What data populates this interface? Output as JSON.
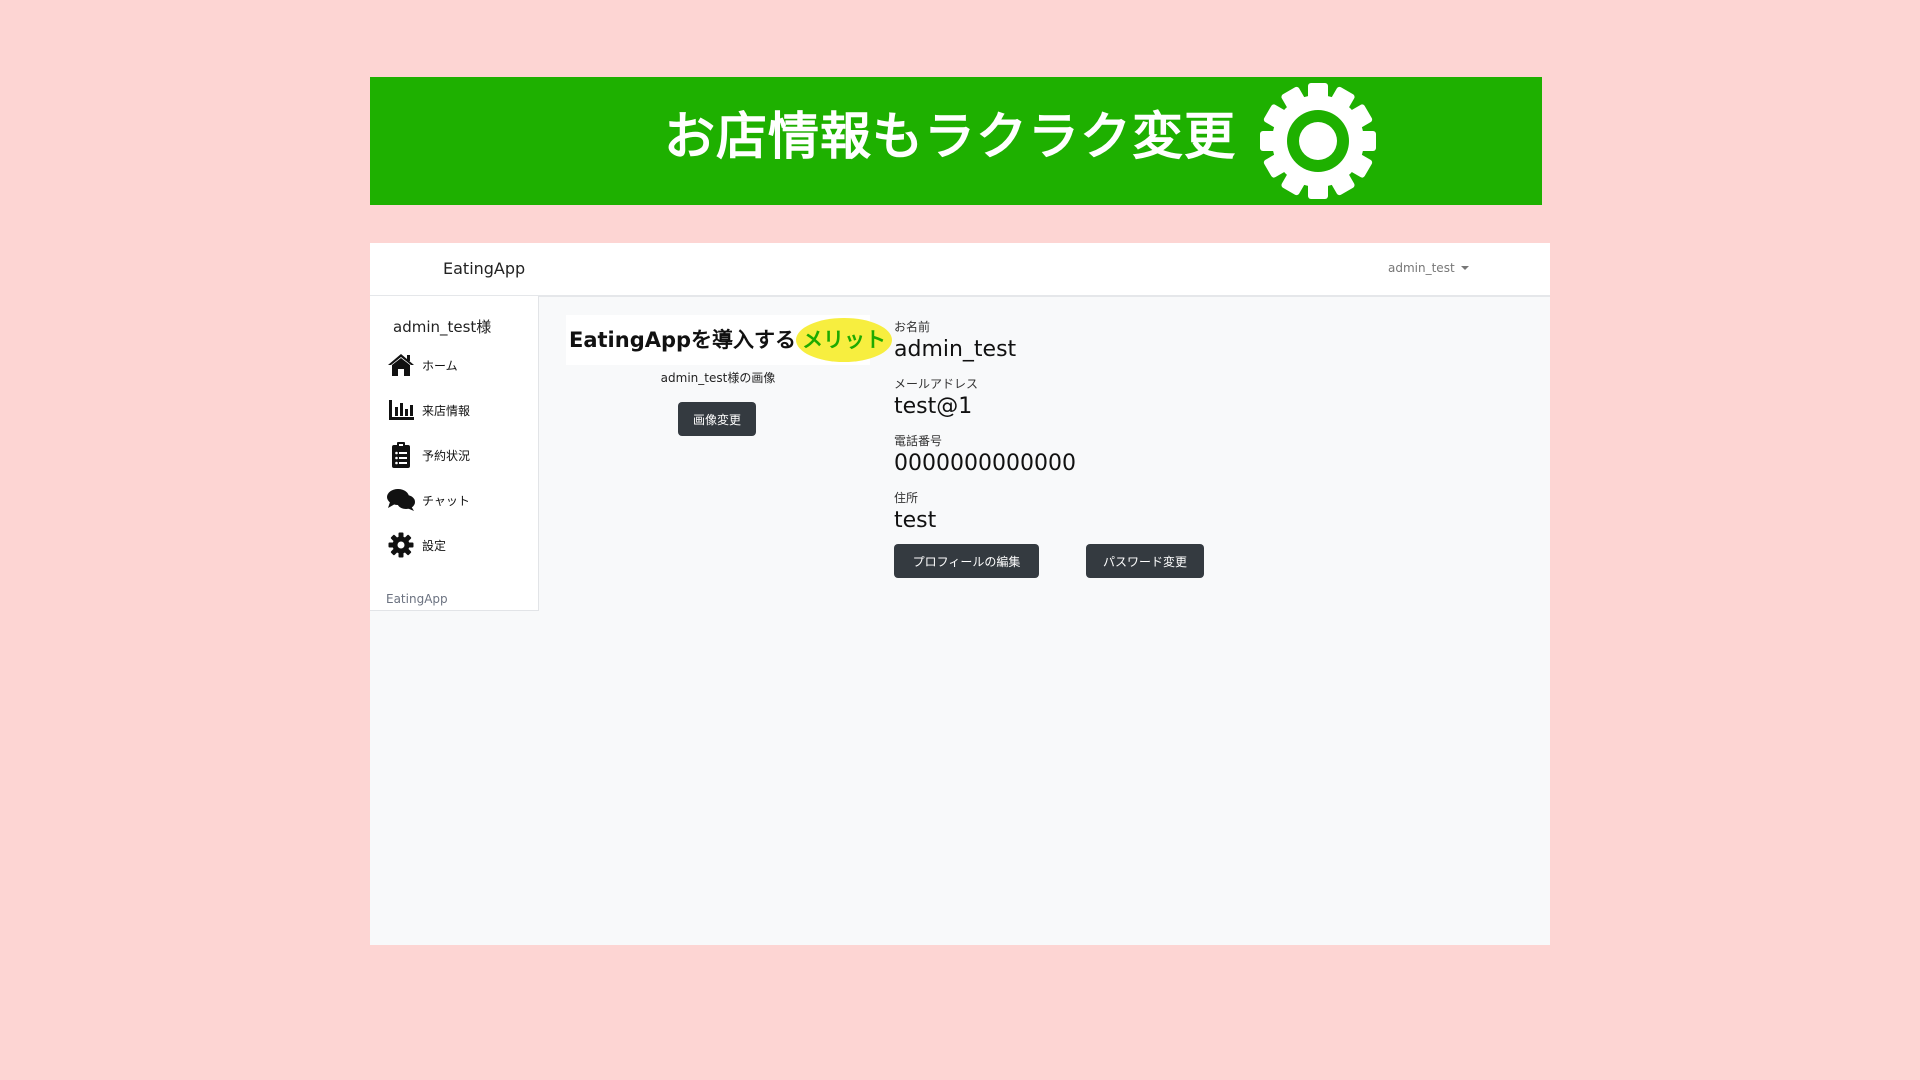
{
  "banner": {
    "title": "お店情報もラクラク変更",
    "icon": "gear-icon",
    "background_color": "#1eb000",
    "text_color": "#ffffff"
  },
  "page": {
    "background_color": "#fdd5d3"
  },
  "navbar": {
    "brand": "EatingApp",
    "user_menu": "admin_test"
  },
  "sidebar": {
    "user_greeting": "admin_test様",
    "items": [
      {
        "label": "ホーム",
        "icon": "home-icon"
      },
      {
        "label": "来店情報",
        "icon": "bar-chart-icon"
      },
      {
        "label": "予約状況",
        "icon": "clipboard-icon"
      },
      {
        "label": "チャット",
        "icon": "chat-icon"
      },
      {
        "label": "設定",
        "icon": "gear-icon"
      }
    ],
    "footer": "EatingApp"
  },
  "main": {
    "merit_text": "EatingAppを導入する",
    "merit_highlight": "メリット",
    "merit_highlight_color": "#f7ee3f",
    "merit_highlight_text_color": "#1eaa00",
    "image_caption": "admin_test様の画像",
    "image_change_button": "画像変更",
    "profile": {
      "name_label": "お名前",
      "name_value": "admin_test",
      "email_label": "メールアドレス",
      "email_value": "test@1",
      "phone_label": "電話番号",
      "phone_value": "0000000000000",
      "address_label": "住所",
      "address_value": "test"
    },
    "edit_profile_button": "プロフィールの編集",
    "change_password_button": "パスワード変更"
  }
}
